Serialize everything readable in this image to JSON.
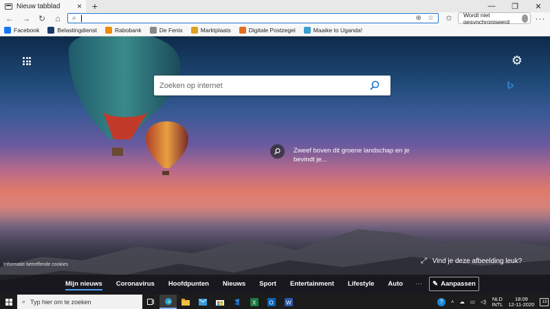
{
  "browser": {
    "tab_title": "Nieuw tabblad",
    "new_tab_symbol": "+",
    "window_controls": [
      "—",
      "❐",
      "✕"
    ],
    "address_value": "",
    "sync_label": "Wordt niet gesynchroniseerd",
    "more_symbol": "···"
  },
  "bookmarks": [
    {
      "label": "Facebook",
      "icon": "facebook-icon",
      "color": "#1877f2"
    },
    {
      "label": "Belastingdienst",
      "icon": "belastingdienst-icon",
      "color": "#1a3a6a"
    },
    {
      "label": "Rabobank",
      "icon": "rabobank-icon",
      "color": "#f08a00"
    },
    {
      "label": "De Fenix",
      "icon": "fenix-icon",
      "color": "#888888"
    },
    {
      "label": "Marktplaats",
      "icon": "marktplaats-icon",
      "color": "#e0a020"
    },
    {
      "label": "Digitale Postzegel",
      "icon": "postzegel-icon",
      "color": "#e07020"
    },
    {
      "label": "Maaike to Uganda!",
      "icon": "uganda-icon",
      "color": "#3aa0d0"
    }
  ],
  "newtab": {
    "search_placeholder": "Zoeken op internet",
    "image_caption": "Zweef boven dit groene landschap en je bevindt je...",
    "cookies_link": "Informatie betreffende cookies",
    "like_image": "Vind je deze afbeelding leuk?",
    "news_tabs": [
      {
        "label": "Mijn nieuws",
        "active": true
      },
      {
        "label": "Coronavirus",
        "active": false
      },
      {
        "label": "Hoofdpunten",
        "active": false
      },
      {
        "label": "Nieuws",
        "active": false
      },
      {
        "label": "Sport",
        "active": false
      },
      {
        "label": "Entertainment",
        "active": false
      },
      {
        "label": "Lifestyle",
        "active": false
      },
      {
        "label": "Auto",
        "active": false
      }
    ],
    "news_more": "···",
    "customize_label": "Aanpassen"
  },
  "taskbar": {
    "search_placeholder": "Typ hier om te zoeken",
    "lang_top": "NLD",
    "lang_bottom": "INTL",
    "time": "18:09",
    "date": "12-11-2020",
    "notification_count": "13"
  }
}
